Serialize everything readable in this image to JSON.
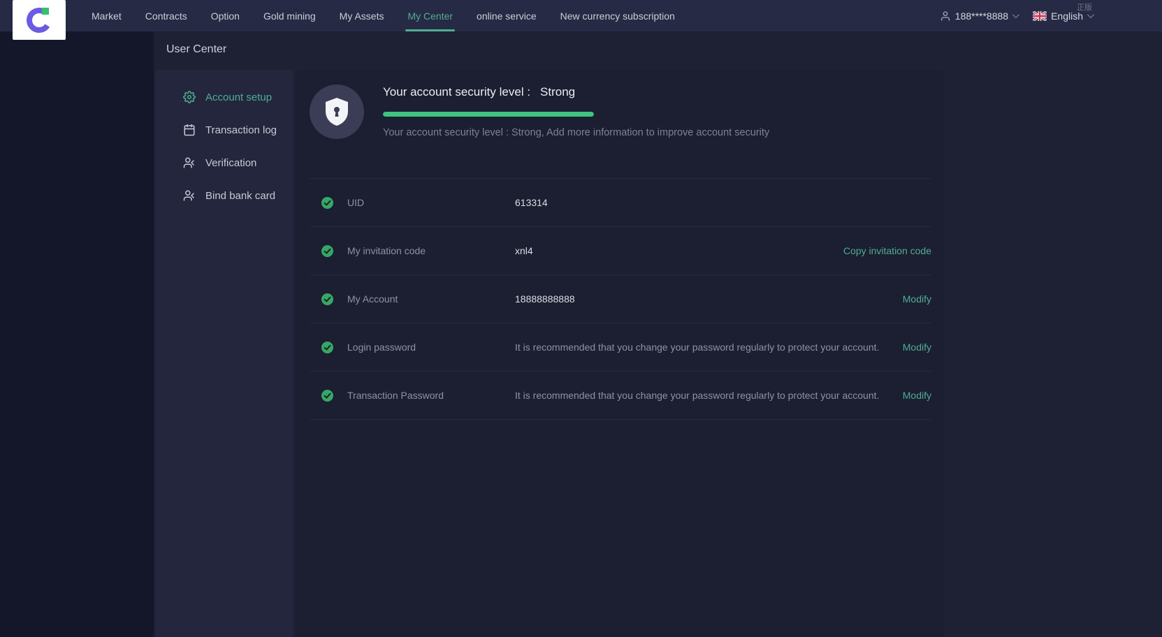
{
  "watermark": "正版",
  "topbar": {
    "nav": [
      {
        "label": "Market"
      },
      {
        "label": "Contracts"
      },
      {
        "label": "Option"
      },
      {
        "label": "Gold mining"
      },
      {
        "label": "My Assets"
      },
      {
        "label": "My Center"
      },
      {
        "label": "online service"
      },
      {
        "label": "New currency subscription"
      }
    ],
    "active_item": "My Center",
    "user_phone": "188****8888",
    "language": "English"
  },
  "page": {
    "title": "User Center"
  },
  "sidebar": {
    "items": [
      {
        "label": "Account setup",
        "icon": "gear-icon"
      },
      {
        "label": "Transaction log",
        "icon": "calendar-icon"
      },
      {
        "label": "Verification",
        "icon": "person-icon"
      },
      {
        "label": "Bind bank card",
        "icon": "person-icon"
      }
    ],
    "active_item": "Account setup"
  },
  "security": {
    "title_label": "Your account security level :",
    "level": "Strong",
    "progress_percent": 100,
    "subtitle": "Your account security level : Strong,  Add more information to improve account security"
  },
  "rows": [
    {
      "label": "UID",
      "value": "613314",
      "action": ""
    },
    {
      "label": "My invitation code",
      "value": "xnl4",
      "action": "Copy invitation code"
    },
    {
      "label": "My Account",
      "value": "18888888888",
      "action": "Modify"
    },
    {
      "label": "Login password",
      "value": "It is recommended that you change your password regularly to protect your account.",
      "action": "Modify"
    },
    {
      "label": "Transaction Password",
      "value": "It is recommended that you change your password regularly to protect your account.",
      "action": "Modify"
    }
  ],
  "colors": {
    "accent": "#4fae94",
    "progress": "#3fc380",
    "check": "#35a865"
  }
}
